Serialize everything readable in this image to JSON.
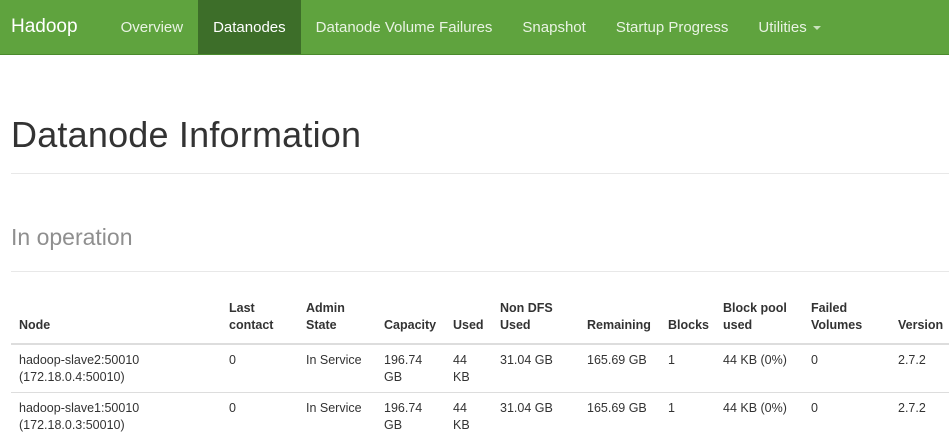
{
  "navbar": {
    "brand": "Hadoop",
    "items": [
      {
        "label": "Overview"
      },
      {
        "label": "Datanodes"
      },
      {
        "label": "Datanode Volume Failures"
      },
      {
        "label": "Snapshot"
      },
      {
        "label": "Startup Progress"
      },
      {
        "label": "Utilities"
      }
    ],
    "active_item": "Datanodes"
  },
  "page": {
    "title": "Datanode Information",
    "section_title": "In operation"
  },
  "table": {
    "headers": {
      "node": "Node",
      "last_contact": "Last contact",
      "admin_state": "Admin State",
      "capacity": "Capacity",
      "used": "Used",
      "non_dfs_used": "Non DFS Used",
      "remaining": "Remaining",
      "blocks": "Blocks",
      "block_pool_used": "Block pool used",
      "failed_volumes": "Failed Volumes",
      "version": "Version"
    },
    "rows": [
      {
        "node_name": "hadoop-slave2:50010",
        "node_addr": "(172.18.0.4:50010)",
        "last_contact": "0",
        "admin_state": "In Service",
        "capacity": "196.74 GB",
        "used": "44 KB",
        "non_dfs_used": "31.04 GB",
        "remaining": "165.69 GB",
        "blocks": "1",
        "block_pool_used": "44 KB (0%)",
        "failed_volumes": "0",
        "version": "2.7.2"
      },
      {
        "node_name": "hadoop-slave1:50010",
        "node_addr": "(172.18.0.3:50010)",
        "last_contact": "0",
        "admin_state": "In Service",
        "capacity": "196.74 GB",
        "used": "44 KB",
        "non_dfs_used": "31.04 GB",
        "remaining": "165.69 GB",
        "blocks": "1",
        "block_pool_used": "44 KB (0%)",
        "failed_volumes": "0",
        "version": "2.7.2"
      }
    ]
  },
  "colors": {
    "navbar_bg": "#5fa33e",
    "navbar_active_bg": "#3d6e29",
    "section_title": "#8f8f8f"
  }
}
